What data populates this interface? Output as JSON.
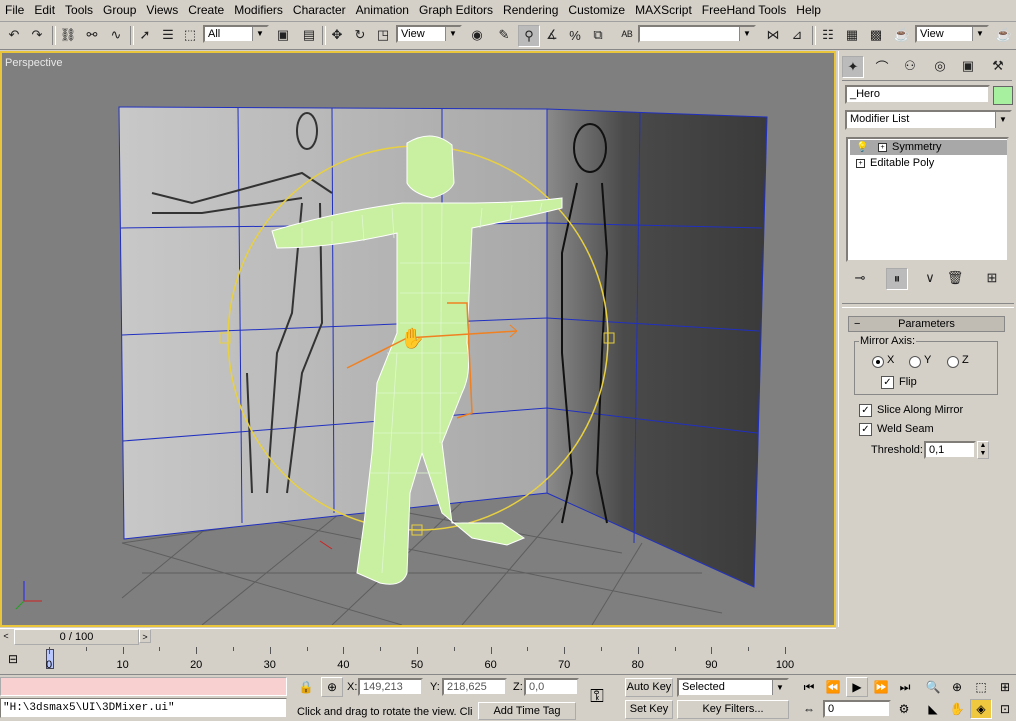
{
  "menu": [
    "File",
    "Edit",
    "Tools",
    "Group",
    "Views",
    "Create",
    "Modifiers",
    "Character",
    "Animation",
    "Graph Editors",
    "Rendering",
    "Customize",
    "MAXScript",
    "FreeHand Tools",
    "Help"
  ],
  "toolbar": {
    "filter_value": "All",
    "refcoord_value": "View",
    "selset_value": "",
    "view2_value": "View",
    "icons": [
      "undo-icon",
      "redo-icon",
      "select-link-icon",
      "unlink-icon",
      "bind-spacewarp-icon",
      "select-object-icon",
      "select-region-icon",
      "select-by-name-icon",
      "move-icon",
      "rotate-icon",
      "scale-icon",
      "mirror-icon",
      "align-icon",
      "layers-icon",
      "curve-editor-icon",
      "render-icon"
    ]
  },
  "viewport": {
    "label": "Perspective"
  },
  "command_panel": {
    "tabs": [
      "create-tab-icon",
      "modify-tab-icon",
      "hierarchy-tab-icon",
      "motion-tab-icon",
      "display-tab-icon",
      "utilities-tab-icon"
    ],
    "object_name": "_Hero",
    "object_color": "#a6f0a0",
    "modifier_list": "Modifier List",
    "stack": [
      {
        "label": "Symmetry",
        "selected": true
      },
      {
        "label": "Editable Poly",
        "selected": false
      }
    ],
    "rollout_title": "Parameters",
    "mirror_axis_label": "Mirror Axis:",
    "axis_options": [
      "X",
      "Y",
      "Z"
    ],
    "axis_selected": "X",
    "flip_label": "Flip",
    "flip_checked": true,
    "slice_label": "Slice Along Mirror",
    "slice_checked": true,
    "weld_label": "Weld Seam",
    "weld_checked": true,
    "threshold_label": "Threshold:",
    "threshold_value": "0,1"
  },
  "timeline": {
    "slider_text": "0 / 100",
    "ticks": [
      "0",
      "10",
      "20",
      "30",
      "40",
      "50",
      "60",
      "70",
      "80",
      "90",
      "100"
    ]
  },
  "status": {
    "maxscript_line": "\"H:\\3dsmax5\\UI\\3DMixer.ui\"",
    "x_label": "X:",
    "x_value": "149,213",
    "y_label": "Y:",
    "y_value": "218,625",
    "z_label": "Z:",
    "z_value": "0,0",
    "prompt": "Click and drag to rotate the view.  Cli",
    "add_time_tag": "Add Time Tag",
    "auto_key": "Auto Key",
    "set_key": "Set Key",
    "selected_value": "Selected",
    "key_filters": "Key Filters...",
    "frame_value": "0"
  },
  "colors": {
    "viewport_bg": "#7f7f7f",
    "active_border": "#e8c53a",
    "mesh": "#c8f0a0",
    "gizmo": "#e8d040",
    "transform": "#f08020"
  }
}
